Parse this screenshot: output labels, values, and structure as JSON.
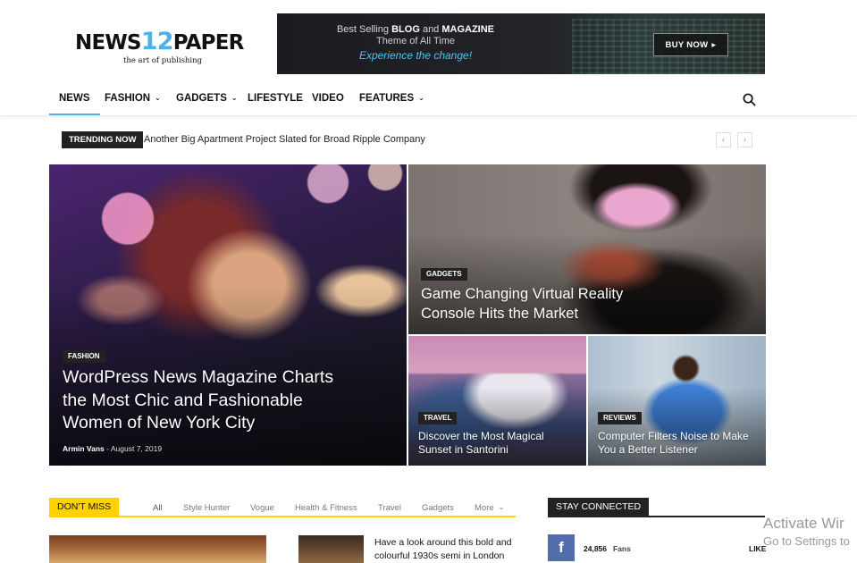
{
  "logo": {
    "prefix": "NEWS",
    "number": "12",
    "suffix": "PAPER",
    "tagline": "the art of publishing"
  },
  "banner": {
    "line1_pre": "Best Selling ",
    "line1_bold1": "BLOG",
    "line1_mid": " and ",
    "line1_bold2": "MAGAZINE",
    "line2": "Theme of All Time",
    "line3": "Experience the change!",
    "button": "BUY NOW",
    "button_icon": "▸"
  },
  "nav": {
    "items": [
      {
        "label": "NEWS"
      },
      {
        "label": "FASHION"
      },
      {
        "label": "GADGETS"
      },
      {
        "label": "LIFESTYLE"
      },
      {
        "label": "VIDEO"
      },
      {
        "label": "FEATURES"
      }
    ],
    "caret": "⌄",
    "active_color": "#4db2ec"
  },
  "trending": {
    "label": "TRENDING NOW",
    "headline": "Another Big Apartment Project Slated for Broad Ripple Company",
    "prev": "‹",
    "next": "›"
  },
  "featured": [
    {
      "category": "FASHION",
      "title": "WordPress News Magazine Charts the Most Chic and Fashionable Women of New York City",
      "author": "Armin Vans",
      "separator": " - ",
      "date": "August 7, 2019"
    },
    {
      "category": "GADGETS",
      "title": "Game Changing Virtual Reality Console Hits the Market"
    },
    {
      "category": "TRAVEL",
      "title": "Discover the Most Magical Sunset in Santorini"
    },
    {
      "category": "REVIEWS",
      "title": "Computer Filters Noise to Make You a Better Listener"
    }
  ],
  "dont_miss": {
    "label": "DON'T MISS",
    "tabs": [
      "All",
      "Style Hunter",
      "Vogue",
      "Health & Fitness",
      "Travel",
      "Gadgets",
      "More"
    ],
    "more_caret": "⌄",
    "news_title": "Have a look around this bold and colourful 1930s semi in London"
  },
  "stay_connected": {
    "label": "STAY CONNECTED",
    "facebook_icon": "f",
    "count": "24,856",
    "unit": "Fans",
    "action": "LIKE"
  },
  "watermark": {
    "line1": "Activate Wir",
    "line2": "Go to Settings to"
  }
}
